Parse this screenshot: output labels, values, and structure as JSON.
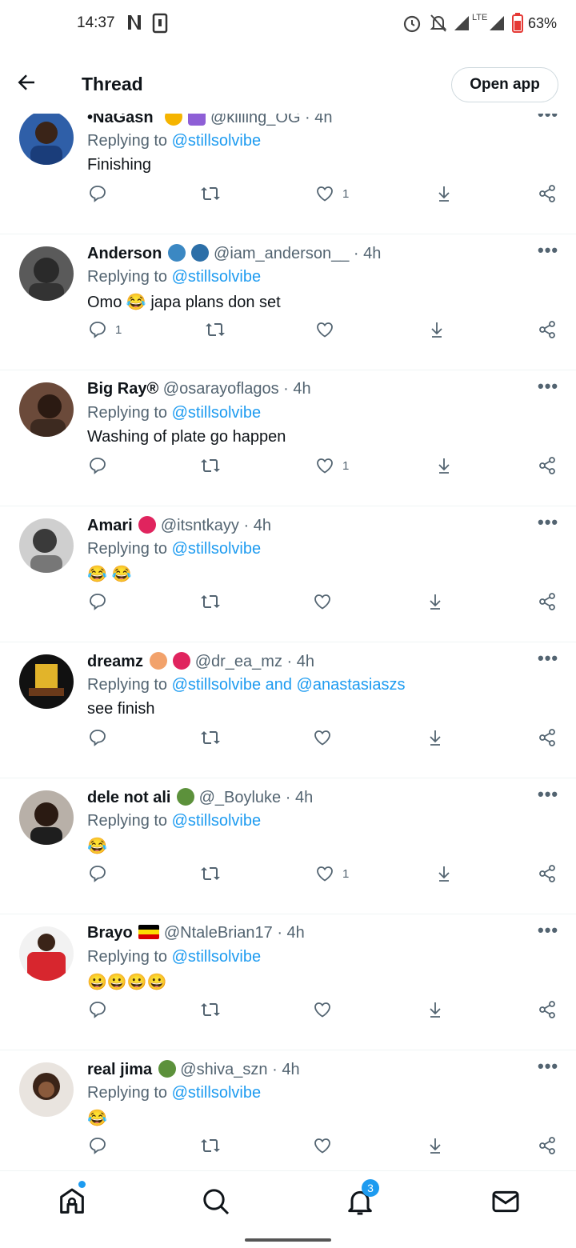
{
  "status_bar": {
    "time": "14:37",
    "battery": "63%",
    "network": "LTE"
  },
  "header": {
    "back_icon": "arrow-left-icon",
    "title": "Thread",
    "open_app_label": "Open app"
  },
  "colors": {
    "accent": "#1d9bf0",
    "muted": "#536471",
    "text": "#0f1419"
  },
  "replies": [
    {
      "name": "•NaGash´",
      "emojis": [
        "sparkles",
        "cancer-sign"
      ],
      "handle": "@killing_OG",
      "time": "4h",
      "replying_prefix": "Replying to",
      "replying_to": "@stillsolvibe",
      "text": "Finishing",
      "likes": "1",
      "comments": "",
      "more": "•••"
    },
    {
      "name": "Anderson",
      "emojis": [
        "dolphin",
        "whale"
      ],
      "handle": "@iam_anderson__",
      "time": "4h",
      "replying_prefix": "Replying to",
      "replying_to": "@stillsolvibe",
      "text": "Omo 😂 japa plans don set",
      "likes": "",
      "comments": "1",
      "more": "•••"
    },
    {
      "name": "Big Ray®",
      "emojis": [],
      "handle": "@osarayoflagos",
      "time": "4h",
      "replying_prefix": "Replying to",
      "replying_to": "@stillsolvibe",
      "text": "Washing of plate go happen",
      "likes": "1",
      "comments": "",
      "more": "•••"
    },
    {
      "name": "Amari",
      "emojis": [
        "two-hearts"
      ],
      "handle": "@itsntkayy",
      "time": "4h",
      "replying_prefix": "Replying to",
      "replying_to": "@stillsolvibe",
      "text": "😂 😂",
      "likes": "",
      "comments": "",
      "more": "•••"
    },
    {
      "name": "dreamz",
      "emojis": [
        "peach",
        "hot-face"
      ],
      "handle": "@dr_ea_mz",
      "time": "4h",
      "replying_prefix": "Replying to",
      "replying_to": "@stillsolvibe and @anastasiaszs",
      "text": "see finish",
      "likes": "",
      "comments": "",
      "more": "•••"
    },
    {
      "name": "dele not ali",
      "emojis": [
        "four-leaf-clover"
      ],
      "handle": "@_Boyluke",
      "time": "4h",
      "replying_prefix": "Replying to",
      "replying_to": "@stillsolvibe",
      "text": "😂",
      "likes": "1",
      "comments": "",
      "more": "•••"
    },
    {
      "name": "Brayo",
      "emojis": [
        "flag-uganda"
      ],
      "handle": "@NtaleBrian17",
      "time": "4h",
      "replying_prefix": "Replying to",
      "replying_to": "@stillsolvibe",
      "text": "😀😀😀😀",
      "likes": "",
      "comments": "",
      "more": "•••"
    },
    {
      "name": "real jima",
      "emojis": [
        "four-leaf-clover"
      ],
      "handle": "@shiva_szn",
      "time": "4h",
      "replying_prefix": "Replying to",
      "replying_to": "@stillsolvibe",
      "text": "😂",
      "likes": "",
      "comments": "",
      "more": "•••"
    }
  ],
  "bottom_nav": {
    "items": [
      "home-icon",
      "search-icon",
      "notifications-icon",
      "messages-icon"
    ],
    "notifications_badge": "3"
  }
}
